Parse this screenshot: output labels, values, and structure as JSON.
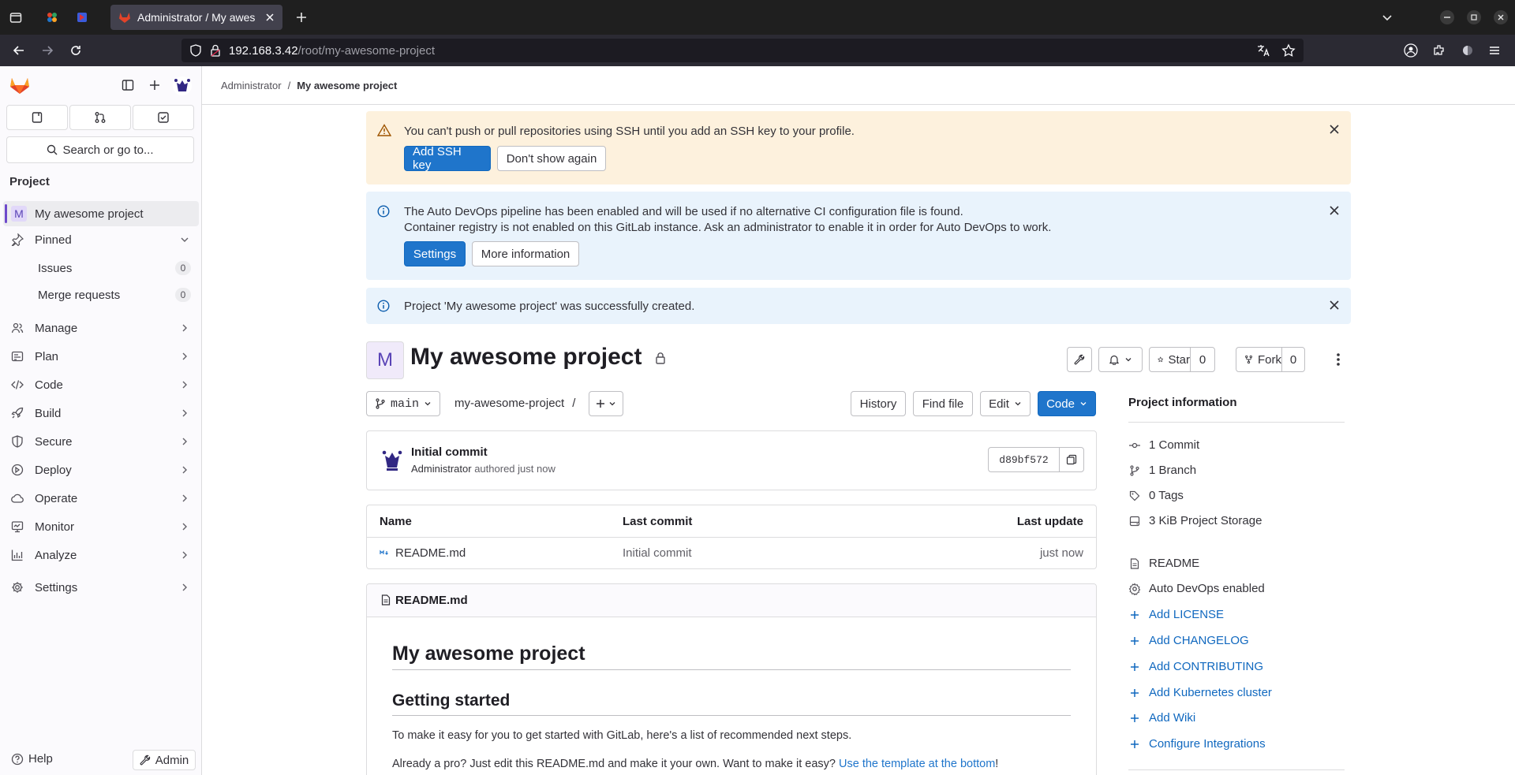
{
  "browser": {
    "tab_title": "Administrator / My awes",
    "url_host": "192.168.3.42",
    "url_path": "/root/my-awesome-project"
  },
  "sidebar": {
    "search_label": "Search or go to...",
    "section_title": "Project",
    "project_avatar_letter": "M",
    "project_name": "My awesome project",
    "pinned_label": "Pinned",
    "pinned_items": [
      {
        "label": "Issues",
        "count": "0"
      },
      {
        "label": "Merge requests",
        "count": "0"
      }
    ],
    "nav_items": [
      {
        "label": "Manage",
        "icon": "users-icon"
      },
      {
        "label": "Plan",
        "icon": "planning-icon"
      },
      {
        "label": "Code",
        "icon": "code-icon"
      },
      {
        "label": "Build",
        "icon": "rocket-icon"
      },
      {
        "label": "Secure",
        "icon": "shield-icon"
      },
      {
        "label": "Deploy",
        "icon": "deployments-icon"
      },
      {
        "label": "Operate",
        "icon": "cloud-icon"
      },
      {
        "label": "Monitor",
        "icon": "monitor-icon"
      },
      {
        "label": "Analyze",
        "icon": "chart-icon"
      },
      {
        "label": "Settings",
        "icon": "gear-icon"
      }
    ],
    "help_label": "Help",
    "admin_label": "Admin"
  },
  "breadcrumb": {
    "parent": "Administrator",
    "separator": "/",
    "current": "My awesome project"
  },
  "alerts": {
    "ssh": {
      "message": "You can't push or pull repositories using SSH until you add an SSH key to your profile.",
      "primary": "Add SSH key",
      "secondary": "Don't show again"
    },
    "devops": {
      "line1": "The Auto DevOps pipeline has been enabled and will be used if no alternative CI configuration file is found.",
      "line2": "Container registry is not enabled on this GitLab instance. Ask an administrator to enable it in order for Auto DevOps to work.",
      "primary": "Settings",
      "secondary": "More information"
    },
    "created": {
      "message": "Project 'My awesome project' was successfully created."
    }
  },
  "project": {
    "avatar_letter": "M",
    "title": "My awesome project",
    "star_label": "Star",
    "star_count": "0",
    "fork_label": "Fork",
    "fork_count": "0"
  },
  "repo": {
    "branch": "main",
    "path": "my-awesome-project",
    "path_sep": "/",
    "history": "History",
    "find_file": "Find file",
    "edit": "Edit",
    "code": "Code",
    "commit_title": "Initial commit",
    "commit_author": "Administrator",
    "commit_meta": "authored just now",
    "commit_sha": "d89bf572",
    "table": {
      "headers": [
        "Name",
        "Last commit",
        "Last update"
      ],
      "rows": [
        {
          "name": "README.md",
          "last_commit": "Initial commit",
          "last_update": "just now"
        }
      ]
    }
  },
  "readme": {
    "file_name": "README.md",
    "h1": "My awesome project",
    "h2": "Getting started",
    "p1": "To make it easy for you to get started with GitLab, here's a list of recommended next steps.",
    "p2_prefix": "Already a pro? Just edit this README.md and make it your own. Want to make it easy? ",
    "p2_link": "Use the template at the bottom",
    "p2_suffix": "!"
  },
  "project_info": {
    "title": "Project information",
    "stats": [
      {
        "label": "1 Commit",
        "icon": "commit-icon"
      },
      {
        "label": "1 Branch",
        "icon": "branch-icon"
      },
      {
        "label": "0 Tags",
        "icon": "tag-icon"
      },
      {
        "label": "3 KiB Project Storage",
        "icon": "disk-icon"
      }
    ],
    "links": [
      {
        "label": "README",
        "icon": "doc-icon",
        "link": false
      },
      {
        "label": "Auto DevOps enabled",
        "icon": "settings-icon",
        "link": false
      },
      {
        "label": "Add LICENSE",
        "icon": "plus-icon",
        "link": true
      },
      {
        "label": "Add CHANGELOG",
        "icon": "plus-icon",
        "link": true
      },
      {
        "label": "Add CONTRIBUTING",
        "icon": "plus-icon",
        "link": true
      },
      {
        "label": "Add Kubernetes cluster",
        "icon": "plus-icon",
        "link": true
      },
      {
        "label": "Add Wiki",
        "icon": "plus-icon",
        "link": true
      },
      {
        "label": "Configure Integrations",
        "icon": "plus-icon",
        "link": true
      }
    ]
  }
}
